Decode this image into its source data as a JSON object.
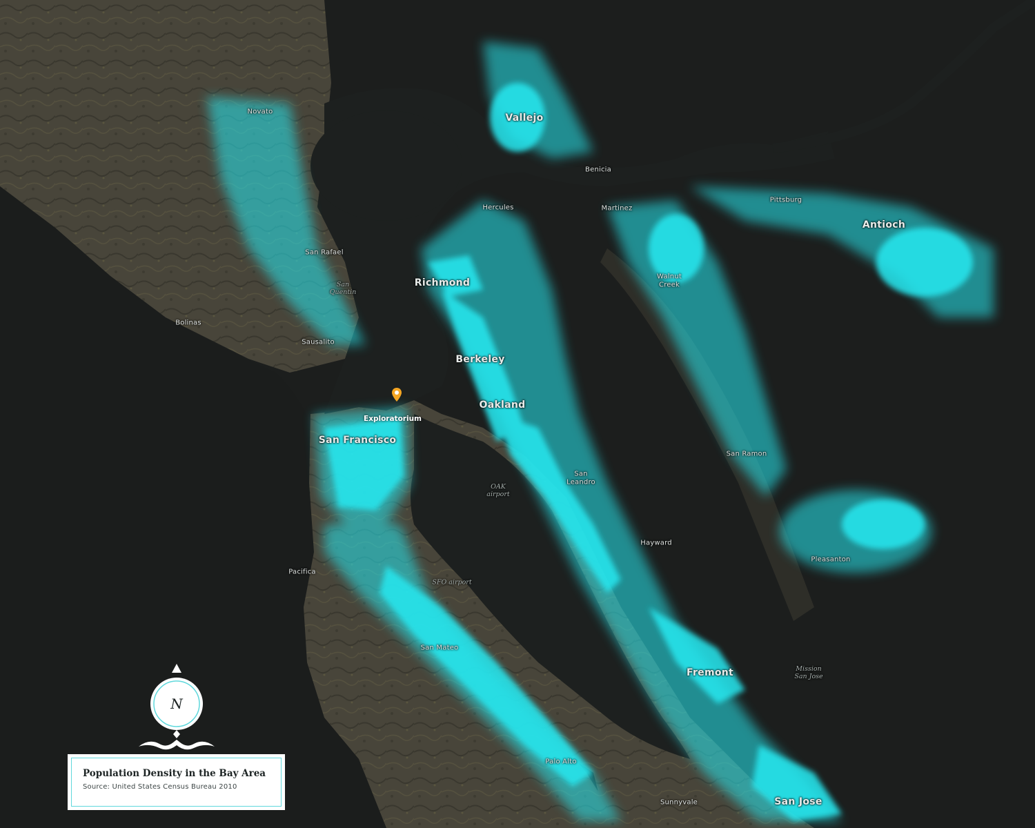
{
  "map": {
    "title": "Population Density in the Bay Area",
    "source": "Source: United States Census Bureau 2010",
    "compass_letter": "N",
    "colors": {
      "water": "#1c1e1d",
      "land": "#4a4639",
      "land_dark": "#35342b",
      "density": "#27e8f0",
      "poi_marker": "#f5a623",
      "legend_border": "#5fd8dc"
    },
    "point_of_interest": {
      "name": "Exploratorium",
      "icon": "map-pin-icon"
    },
    "cities_major": [
      "Vallejo",
      "Richmond",
      "Berkeley",
      "Oakland",
      "San Francisco",
      "Antioch",
      "Fremont",
      "San Jose"
    ],
    "cities_minor": [
      "Novato",
      "San Rafael",
      "Bolinas",
      "Sausalito",
      "Benicia",
      "Hercules",
      "Martinez",
      "Pittsburg",
      "Walnut\nCreek",
      "San Ramon",
      "San\nLeandro",
      "Hayward",
      "Pleasanton",
      "Pacifica",
      "San Mateo",
      "Palo Alto",
      "Sunnyvale"
    ],
    "water_labels": [
      "San\nQuentin",
      "OAK\nairport",
      "SFO airport",
      "Mission\nSan Jose"
    ]
  }
}
